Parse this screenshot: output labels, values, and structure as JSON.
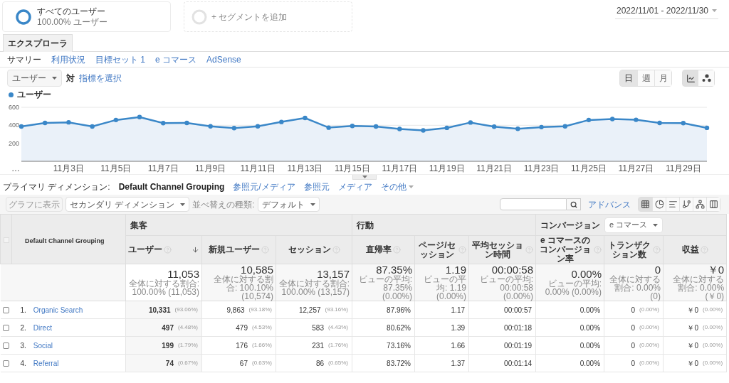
{
  "segments": [
    {
      "kind": "active",
      "title": "すべてのユーザー",
      "subtitle": "100.00% ユーザー"
    },
    {
      "kind": "add",
      "title": "+ セグメントを追加"
    }
  ],
  "date_range": "2022/11/01 - 2022/11/30",
  "tabs": [
    {
      "label": "エクスプローラ",
      "selected": true
    }
  ],
  "subnav": [
    {
      "label": "サマリー",
      "selected": true
    },
    {
      "label": "利用状況",
      "selected": false
    },
    {
      "label": "目標セット 1",
      "selected": false
    },
    {
      "label": "e コマース",
      "selected": false
    },
    {
      "label": "AdSense",
      "selected": false
    }
  ],
  "metric_selector": {
    "value": "ユーザー",
    "versus": "対",
    "link": "指標を選択"
  },
  "period_buttons": [
    {
      "label": "日",
      "selected": true
    },
    {
      "label": "週",
      "selected": false
    },
    {
      "label": "月",
      "selected": false
    }
  ],
  "chart_type_buttons": [
    {
      "kind": "line",
      "selected": true
    },
    {
      "kind": "motion",
      "selected": false
    }
  ],
  "chart": {
    "chart_data": {
      "type": "area",
      "categories": [
        "…",
        null,
        "11月3日",
        null,
        "11月5日",
        null,
        "11月7日",
        null,
        "11月9日",
        null,
        "11月11日",
        null,
        "11月13日",
        null,
        "11月15日",
        null,
        "11月17日",
        null,
        "11月19日",
        null,
        "11月21日",
        null,
        "11月23日",
        null,
        "11月25日",
        null,
        "11月27日",
        null,
        "11月29日",
        null
      ],
      "series": [
        {
          "name": "ユーザー",
          "color": "#3a87c8",
          "values": [
            387,
            426,
            433,
            387,
            459,
            492,
            424,
            426,
            389,
            369,
            389,
            437,
            481,
            374,
            393,
            387,
            359,
            343,
            372,
            431,
            385,
            361,
            380,
            389,
            459,
            470,
            461,
            426,
            424,
            372
          ]
        }
      ],
      "ylim": [
        0,
        600
      ],
      "yticks": [
        200,
        400,
        600
      ]
    }
  },
  "primary_dimension": {
    "label": "プライマリ ディメンション:",
    "options": [
      {
        "label": "Default Channel Grouping",
        "selected": true,
        "dropdown": false
      },
      {
        "label": "参照元/メディア",
        "selected": false,
        "dropdown": false
      },
      {
        "label": "参照元",
        "selected": false,
        "dropdown": false
      },
      {
        "label": "メディア",
        "selected": false,
        "dropdown": false
      },
      {
        "label": "その他",
        "selected": false,
        "dropdown": true
      }
    ]
  },
  "toolbar": {
    "plot_button": {
      "label": "グラフに表示",
      "disabled": true
    },
    "secondary_dimension": "セカンダリ ディメンション",
    "sort_label": "並べ替えの種類:",
    "sort_value": "デフォルト",
    "advanced_link": "アドバンス",
    "view_buttons": [
      {
        "kind": "table",
        "selected": true
      },
      {
        "kind": "pie",
        "selected": false
      },
      {
        "kind": "bars",
        "selected": false
      },
      {
        "kind": "comparison",
        "selected": false
      },
      {
        "kind": "pivot",
        "selected": false
      },
      {
        "kind": "columns",
        "selected": false
      }
    ]
  },
  "table": {
    "select_all": {
      "checked": false,
      "disabled": true
    },
    "dimension_header": "Default Channel Grouping",
    "groups": [
      {
        "kind": "plain",
        "label": "集客",
        "columns": [
          {
            "label": "ユーザー",
            "sorted": true
          },
          {
            "label": "新規ユーザー",
            "sorted": false
          },
          {
            "label": "セッション",
            "sorted": false
          }
        ]
      },
      {
        "kind": "plain",
        "label": "行動",
        "columns": [
          {
            "label": "直帰率",
            "sorted": false
          },
          {
            "label": "ページ/セッション",
            "sorted": false
          },
          {
            "label": "平均セッション時間",
            "sorted": false
          }
        ]
      },
      {
        "kind": "dropdown",
        "label": "コンバージョン",
        "value": "e コマース",
        "columns": [
          {
            "label": "e コマースのコンバージョン率",
            "sorted": false
          },
          {
            "label": "トランザクション数",
            "sorted": false
          },
          {
            "label": "収益",
            "sorted": false
          }
        ]
      }
    ],
    "totals": [
      {
        "value": "11,053",
        "sub": "全体に対する割合: 100.00% (11,053)"
      },
      {
        "value": "10,585",
        "sub": "全体に対する割合: 100.10% (10,574)"
      },
      {
        "value": "13,157",
        "sub": "全体に対する割合: 100.00% (13,157)"
      },
      {
        "value": "87.35%",
        "sub": "ビューの平均: 87.35% (0.00%)"
      },
      {
        "value": "1.19",
        "sub": "ビューの平均: 1.19 (0.00%)"
      },
      {
        "value": "00:00:58",
        "sub": "ビューの平均: 00:00:58 (0.00%)"
      },
      {
        "value": "0.00%",
        "sub": "ビューの平均: 0.00% (0.00%)"
      },
      {
        "value": "0",
        "sub": "全体に対する割合: 0.00% (0)"
      },
      {
        "value": "￥0",
        "sub": "全体に対する割合: 0.00% (￥0)"
      }
    ],
    "rows": [
      {
        "number": "1.",
        "name": "Organic Search",
        "checked": false,
        "cells": [
          {
            "value": "10,331",
            "share": "(93.06%)"
          },
          {
            "value": "9,863",
            "share": "(93.18%)"
          },
          {
            "value": "12,257",
            "share": "(93.16%)"
          },
          {
            "value": "87.96%"
          },
          {
            "value": "1.17"
          },
          {
            "value": "00:00:57"
          },
          {
            "value": "0.00%"
          },
          {
            "value": "0",
            "share": "(0.00%)"
          },
          {
            "value": "￥0",
            "share": "(0.00%)"
          }
        ]
      },
      {
        "number": "2.",
        "name": "Direct",
        "checked": false,
        "cells": [
          {
            "value": "497",
            "share": "(4.48%)"
          },
          {
            "value": "479",
            "share": "(4.53%)"
          },
          {
            "value": "583",
            "share": "(4.43%)"
          },
          {
            "value": "80.62%"
          },
          {
            "value": "1.39"
          },
          {
            "value": "00:01:18"
          },
          {
            "value": "0.00%"
          },
          {
            "value": "0",
            "share": "(0.00%)"
          },
          {
            "value": "￥0",
            "share": "(0.00%)"
          }
        ]
      },
      {
        "number": "3.",
        "name": "Social",
        "checked": false,
        "cells": [
          {
            "value": "199",
            "share": "(1.79%)"
          },
          {
            "value": "176",
            "share": "(1.66%)"
          },
          {
            "value": "231",
            "share": "(1.76%)"
          },
          {
            "value": "73.16%"
          },
          {
            "value": "1.66"
          },
          {
            "value": "00:01:19"
          },
          {
            "value": "0.00%"
          },
          {
            "value": "0",
            "share": "(0.00%)"
          },
          {
            "value": "￥0",
            "share": "(0.00%)"
          }
        ]
      },
      {
        "number": "4.",
        "name": "Referral",
        "checked": false,
        "cells": [
          {
            "value": "74",
            "share": "(0.67%)"
          },
          {
            "value": "67",
            "share": "(0.63%)"
          },
          {
            "value": "86",
            "share": "(0.65%)"
          },
          {
            "value": "83.72%"
          },
          {
            "value": "1.37"
          },
          {
            "value": "00:01:14"
          },
          {
            "value": "0.00%"
          },
          {
            "value": "0",
            "share": "(0.00%)"
          },
          {
            "value": "￥0",
            "share": "(0.00%)"
          }
        ]
      }
    ]
  }
}
